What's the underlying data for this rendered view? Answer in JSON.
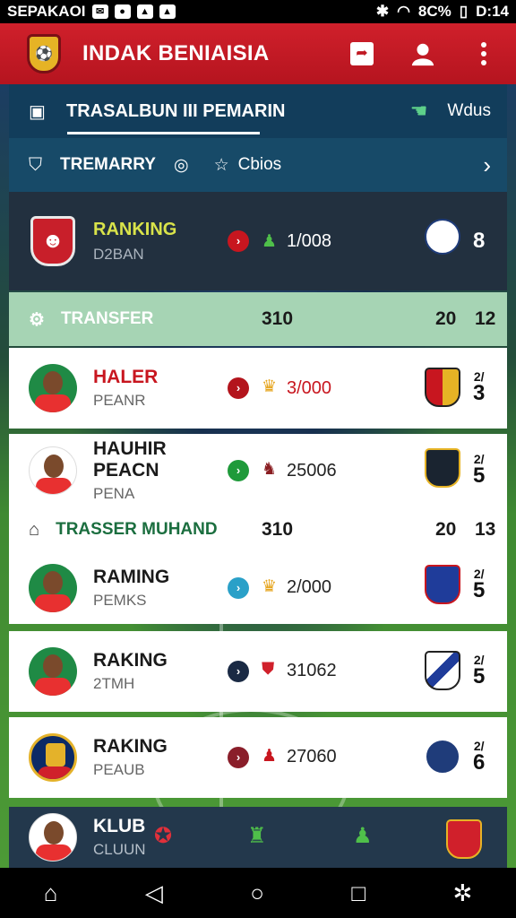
{
  "status_bar": {
    "carrier": "SEPAKAOI",
    "battery": "8C%",
    "time": "D:14"
  },
  "app": {
    "title": "INDAK BENIAISIA"
  },
  "header": {
    "tab_label": "TRASALBUN III PEMARIN",
    "right_label": "Wdus"
  },
  "subheader": {
    "label": "TREMARRY",
    "mid_label": "Cbios"
  },
  "ranking_card": {
    "title": "RANKING",
    "subtitle": "D2BAN",
    "value": "1/008",
    "score": "8"
  },
  "transfer_bar_1": {
    "label": "TRANSFER",
    "mid": "310",
    "r1": "20",
    "r2": "12"
  },
  "transfer_bar_2": {
    "label": "TRASSER MUHAND",
    "mid": "310",
    "r1": "20",
    "r2": "13"
  },
  "players": [
    {
      "name": "HALER",
      "sub": "PEANR",
      "value": "3/000",
      "score_top": "2/",
      "score": "3"
    },
    {
      "name": "HAUHIR PEACN",
      "sub": "PENA",
      "value": "25006",
      "score_top": "2/",
      "score": "5"
    },
    {
      "name": "RAMING",
      "sub": "PEMKS",
      "value": "2/000",
      "score_top": "2/",
      "score": "5"
    },
    {
      "name": "RAKING",
      "sub": "2TMH",
      "value": "31062",
      "score_top": "2/",
      "score": "5"
    },
    {
      "name": "RAKING",
      "sub": "PEAUB",
      "value": "27060",
      "score_top": "2/",
      "score": "6"
    }
  ],
  "bottom_tab": {
    "name": "KLUB",
    "sub": "CLUUN"
  },
  "colors": {
    "brand_red": "#c8161f",
    "header_blue": "#123d5b",
    "transfer_green": "#a6d4b4"
  }
}
